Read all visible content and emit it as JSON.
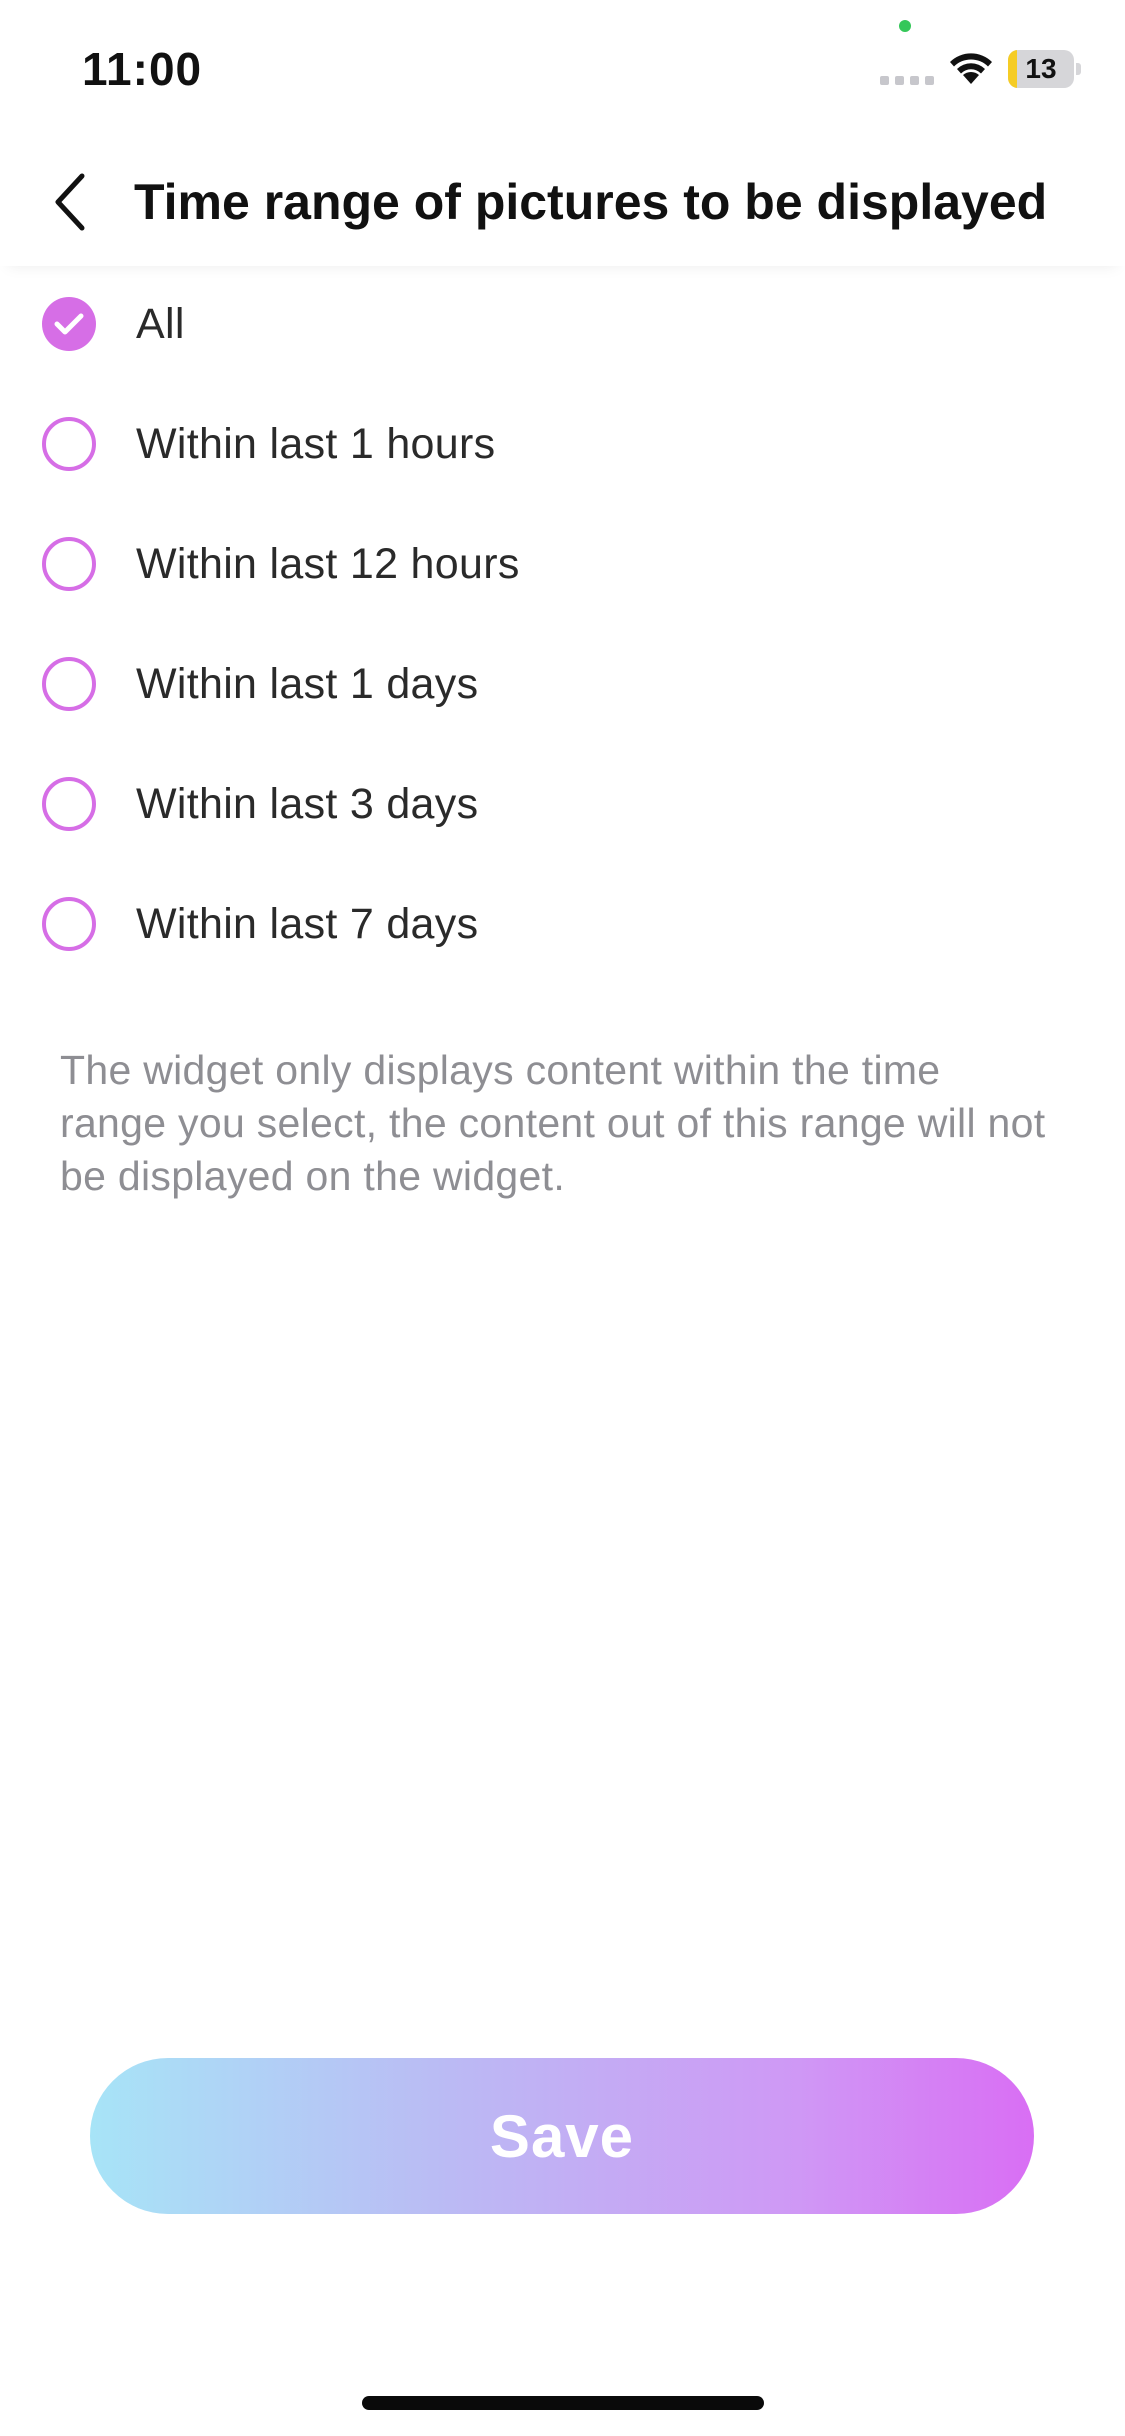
{
  "status_bar": {
    "time": "11:00",
    "battery_level": "13",
    "battery_fraction": 0.13
  },
  "header": {
    "back_icon": "chevron-left-icon",
    "title": "Time range of pictures to be displayed"
  },
  "options": [
    {
      "label": "All",
      "selected": true
    },
    {
      "label": "Within last 1 hours",
      "selected": false
    },
    {
      "label": "Within last 12 hours",
      "selected": false
    },
    {
      "label": "Within last 1 days",
      "selected": false
    },
    {
      "label": "Within last 3 days",
      "selected": false
    },
    {
      "label": "Within last 7 days",
      "selected": false
    }
  ],
  "description": "The widget only displays content within the time range you select, the content out of this range will not be displayed on the widget.",
  "save_button": {
    "label": "Save"
  },
  "colors": {
    "accent": "#d66ee6",
    "description_text": "#8e8e93",
    "gradient_start": "#a7e4f7",
    "gradient_end": "#d96ef4",
    "battery_low": "#f5cc25"
  }
}
